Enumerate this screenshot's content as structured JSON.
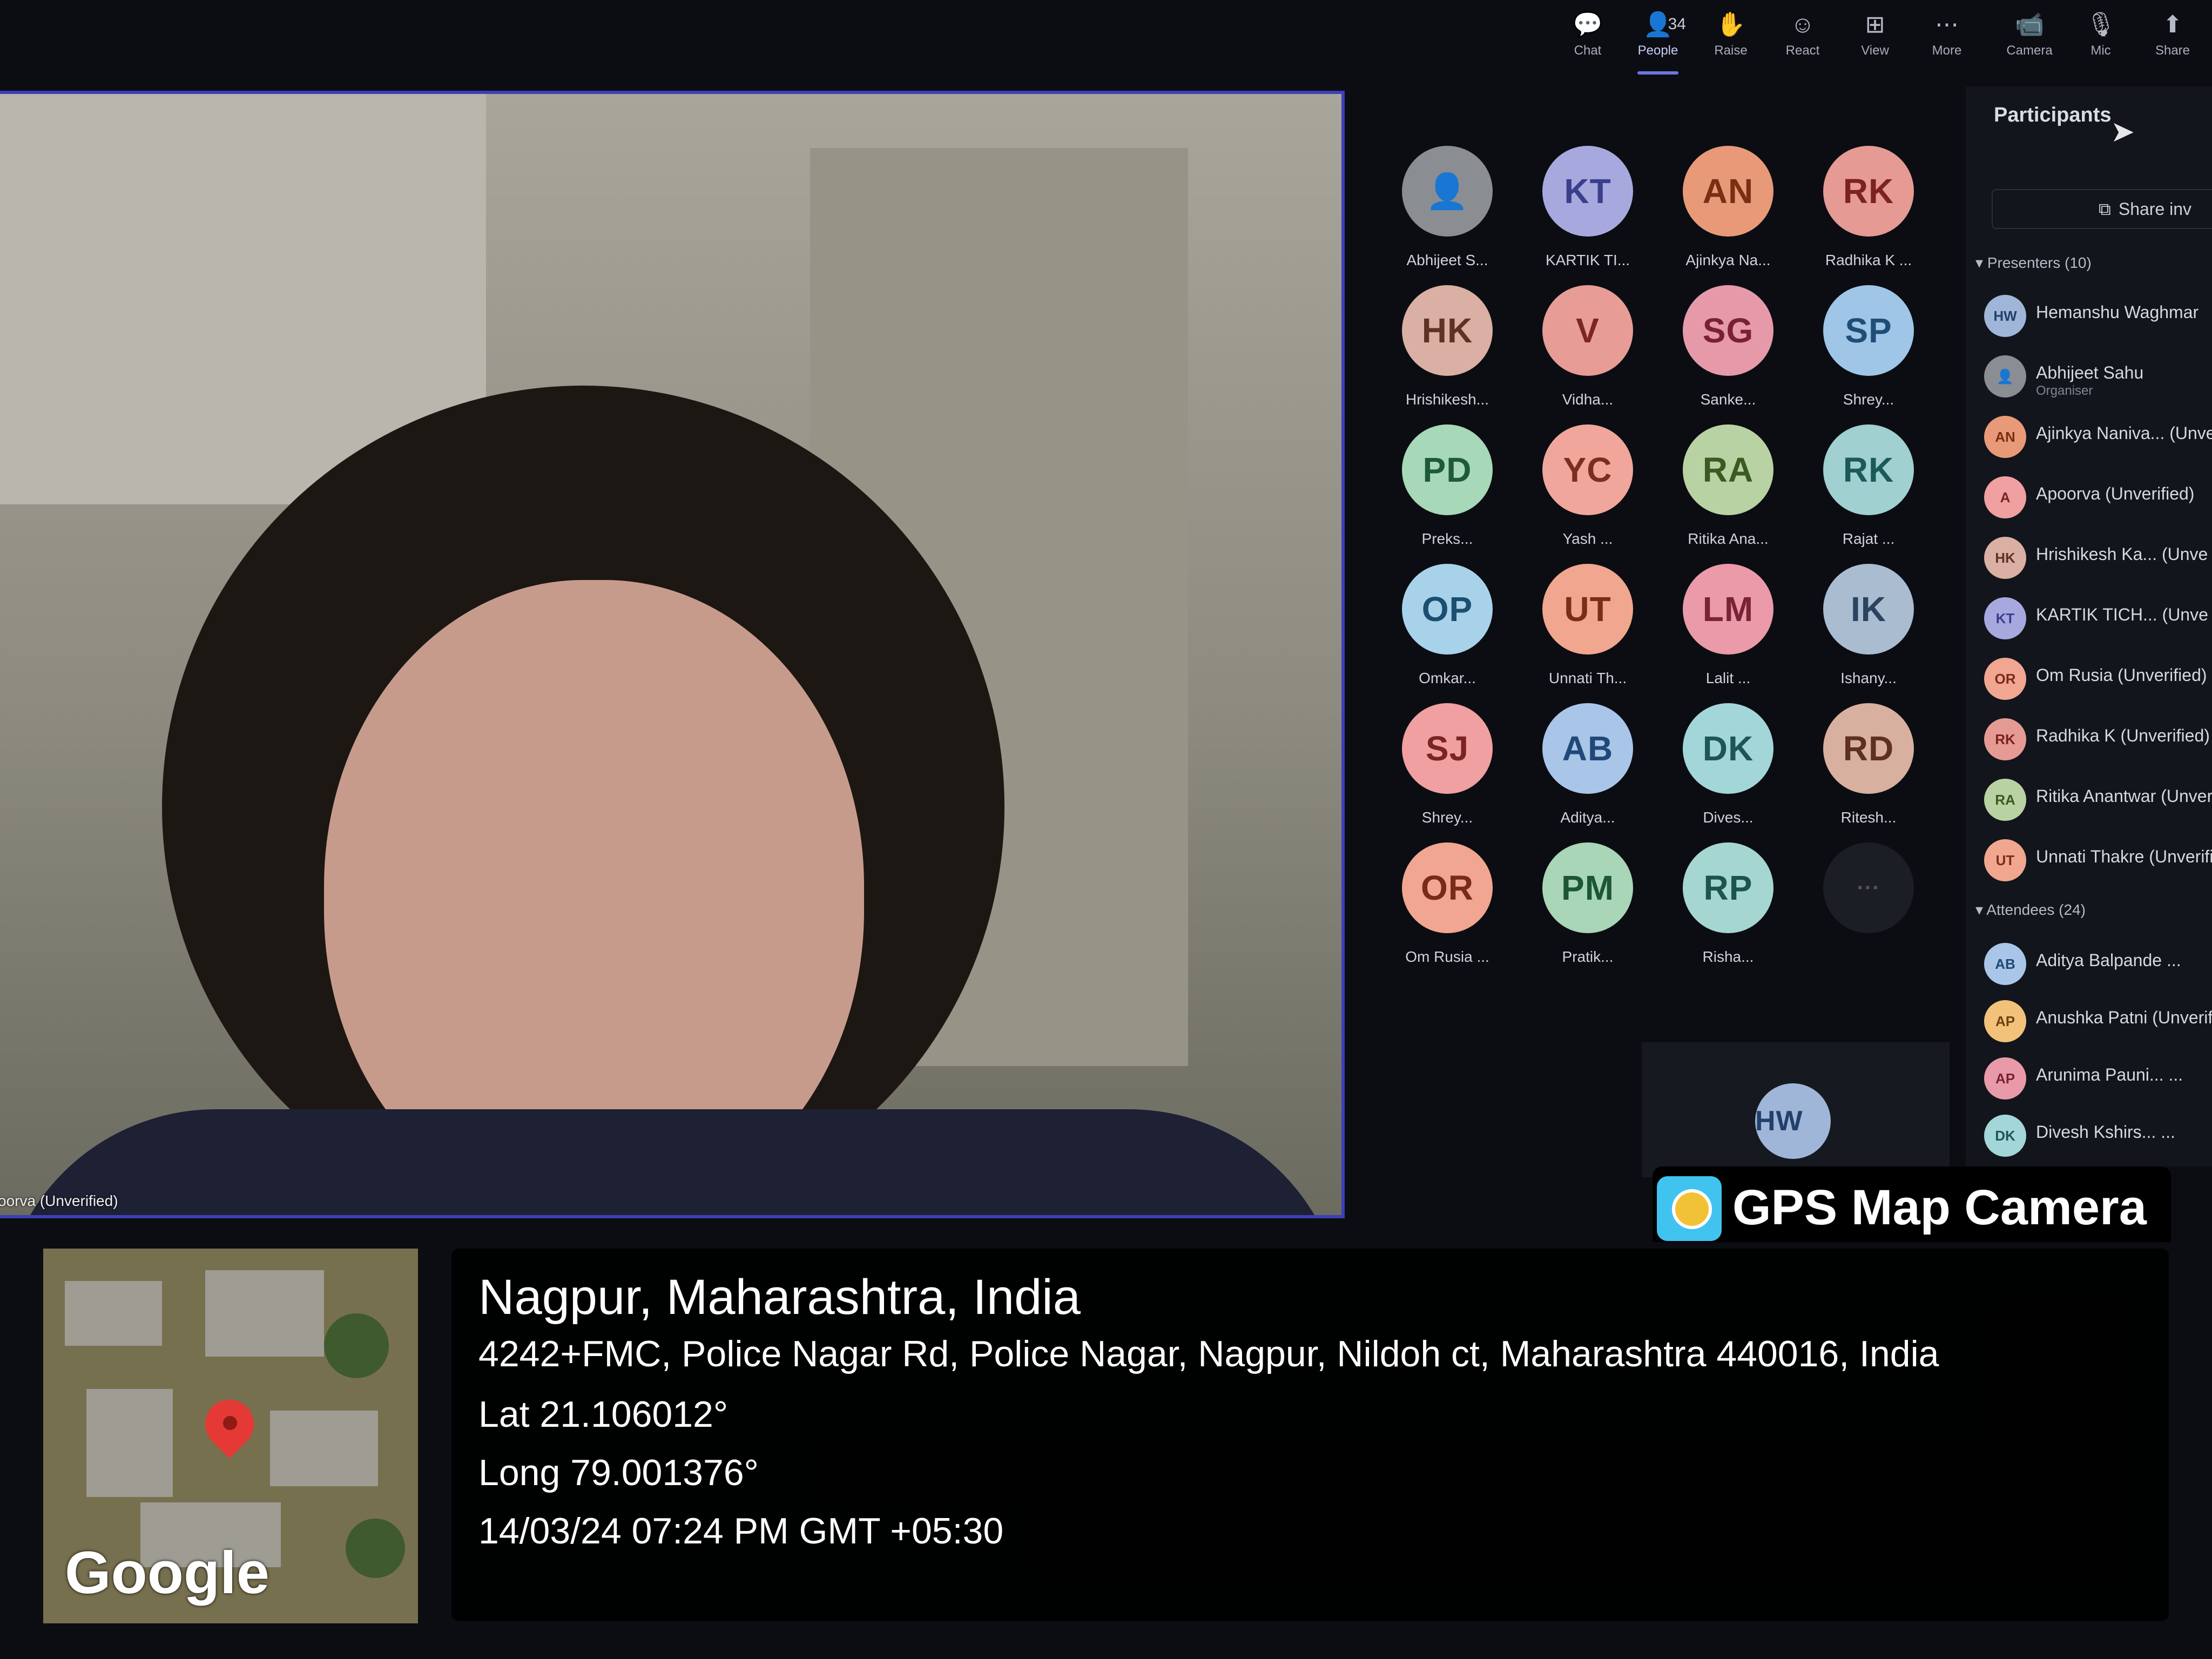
{
  "toolbar": {
    "buttons": [
      {
        "label": "Chat",
        "icon": "chat-icon",
        "glyph": "💬"
      },
      {
        "label": "People",
        "icon": "people-icon",
        "glyph": "👤",
        "count": "34"
      },
      {
        "label": "Raise",
        "icon": "raise-hand-icon",
        "glyph": "✋"
      },
      {
        "label": "React",
        "icon": "react-icon",
        "glyph": "☺"
      },
      {
        "label": "View",
        "icon": "view-icon",
        "glyph": "⊞"
      },
      {
        "label": "More",
        "icon": "more-icon",
        "glyph": "⋯"
      },
      {
        "label": "Camera",
        "icon": "camera-icon",
        "glyph": "📹"
      },
      {
        "label": "Mic",
        "icon": "mic-icon",
        "glyph": "🎙"
      },
      {
        "label": "Share",
        "icon": "share-icon",
        "glyph": "⬆"
      }
    ]
  },
  "video": {
    "name": "oorva (Unverified)"
  },
  "grid": {
    "tiles": [
      {
        "initials": "",
        "name": "Abhijeet S...",
        "bg": "#8a8d92",
        "fg": "#dfe2e6"
      },
      {
        "initials": "KT",
        "name": "KARTIK TI...",
        "bg": "#a7a9de",
        "fg": "#3a3f8c"
      },
      {
        "initials": "AN",
        "name": "Ajinkya Na...",
        "bg": "#e89a78",
        "fg": "#7a2e12"
      },
      {
        "initials": "RK",
        "name": "Radhika K ...",
        "bg": "#e59a94",
        "fg": "#7c2220"
      },
      {
        "initials": "HK",
        "name": "Hrishikesh...",
        "bg": "#d9b0a3",
        "fg": "#5e3326"
      },
      {
        "initials": "V",
        "name": "Vidha...",
        "bg": "#e79c96",
        "fg": "#7b2622"
      },
      {
        "initials": "SG",
        "name": "Sanke...",
        "bg": "#e69aa9",
        "fg": "#7a2035"
      },
      {
        "initials": "SP",
        "name": "Shrey...",
        "bg": "#9fc6e6",
        "fg": "#1e4e78"
      },
      {
        "initials": "PD",
        "name": "Preks...",
        "bg": "#a7d8b8",
        "fg": "#1e5a36"
      },
      {
        "initials": "YC",
        "name": "Yash ...",
        "bg": "#f0a69a",
        "fg": "#7a2e22"
      },
      {
        "initials": "RA",
        "name": "Ritika Ana...",
        "bg": "#b9d2a3",
        "fg": "#3a5a22"
      },
      {
        "initials": "RK",
        "name": "Rajat ...",
        "bg": "#a0d0d0",
        "fg": "#1c5a5a"
      },
      {
        "initials": "OP",
        "name": "Omkar...",
        "bg": "#a8d2ea",
        "fg": "#1c4e70"
      },
      {
        "initials": "UT",
        "name": "Unnati Th...",
        "bg": "#f0a68f",
        "fg": "#7a2e1a"
      },
      {
        "initials": "LM",
        "name": "Lalit ...",
        "bg": "#ea9aa8",
        "fg": "#7a2236"
      },
      {
        "initials": "IK",
        "name": "Ishany...",
        "bg": "#a9bcd0",
        "fg": "#2a4460"
      },
      {
        "initials": "SJ",
        "name": "Shrey...",
        "bg": "#f0a0a0",
        "fg": "#7a2424"
      },
      {
        "initials": "AB",
        "name": "Aditya...",
        "bg": "#a9c6e8",
        "fg": "#204878"
      },
      {
        "initials": "DK",
        "name": "Dives...",
        "bg": "#a3d6d8",
        "fg": "#1c5658"
      },
      {
        "initials": "RD",
        "name": "Ritesh...",
        "bg": "#d8b0a0",
        "fg": "#5e3020"
      },
      {
        "initials": "OR",
        "name": "Om Rusia ...",
        "bg": "#f0a690",
        "fg": "#7a2a18"
      },
      {
        "initials": "PM",
        "name": "Pratik...",
        "bg": "#a8d6b6",
        "fg": "#1c5634"
      },
      {
        "initials": "RP",
        "name": "Risha...",
        "bg": "#a6d6d2",
        "fg": "#1c5450"
      },
      {
        "initials": "···",
        "name": "",
        "bg": "#1b1e25",
        "fg": "#555"
      }
    ],
    "lower_avatar": {
      "initials": "HW",
      "bg": "#9fb6d8",
      "fg": "#22406a"
    }
  },
  "panel": {
    "title": "Participants",
    "share_label": "Share inv",
    "presenters_label": "Presenters (10)",
    "attendees_label": "Attendees (24)",
    "presenters": [
      {
        "initials": "HW",
        "name": "Hemanshu Waghmar",
        "sub": "",
        "bg": "#9fb6d8",
        "fg": "#22406a"
      },
      {
        "initials": "",
        "name": "Abhijeet Sahu",
        "sub": "Organiser",
        "bg": "#8a8d92",
        "fg": "#dfe2e6"
      },
      {
        "initials": "AN",
        "name": "Ajinkya Naniva... (Unve",
        "sub": "",
        "bg": "#e89a78",
        "fg": "#7a2e12"
      },
      {
        "initials": "A",
        "name": "Apoorva (Unverified)",
        "sub": "",
        "bg": "#f0a0a0",
        "fg": "#7a2424"
      },
      {
        "initials": "HK",
        "name": "Hrishikesh Ka...  (Unve",
        "sub": "",
        "bg": "#d9b0a3",
        "fg": "#5e3326"
      },
      {
        "initials": "KT",
        "name": "KARTIK TICH...  (Unve",
        "sub": "",
        "bg": "#a7a9de",
        "fg": "#3a3f8c"
      },
      {
        "initials": "OR",
        "name": "Om Rusia (Unverified)",
        "sub": "",
        "bg": "#f0a690",
        "fg": "#7a2a18"
      },
      {
        "initials": "RK",
        "name": "Radhika K (Unverified)",
        "sub": "",
        "bg": "#e59a94",
        "fg": "#7c2220"
      },
      {
        "initials": "RA",
        "name": "Ritika Anantwar (Unveri",
        "sub": "",
        "bg": "#b9d2a3",
        "fg": "#3a5a22"
      },
      {
        "initials": "UT",
        "name": "Unnati Thakre (Unverifie",
        "sub": "",
        "bg": "#f0a68f",
        "fg": "#7a2e1a"
      }
    ],
    "attendees": [
      {
        "initials": "AB",
        "name": "Aditya Balpande ...",
        "bg": "#a9c6e8",
        "fg": "#204878"
      },
      {
        "initials": "AP",
        "name": "Anushka Patni (Unverifie",
        "bg": "#f2c27a",
        "fg": "#6a4210"
      },
      {
        "initials": "AP",
        "name": "Arunima Pauni...  ...",
        "bg": "#e89aa8",
        "fg": "#7a2236"
      },
      {
        "initials": "DK",
        "name": "Divesh Kshirs...   ...",
        "bg": "#a3d6d8",
        "fg": "#1c5658"
      }
    ]
  },
  "gps": {
    "badge_title": "GPS Map Camera",
    "city": "Nagpur, Maharashtra, India",
    "address": "4242+FMC, Police Nagar Rd, Police Nagar, Nagpur, Nildoh ct, Maharashtra 440016, India",
    "lat": "Lat 21.106012°",
    "long": "Long 79.001376°",
    "datetime": "14/03/24 07:24 PM GMT +05:30",
    "map_logo": "Google"
  }
}
